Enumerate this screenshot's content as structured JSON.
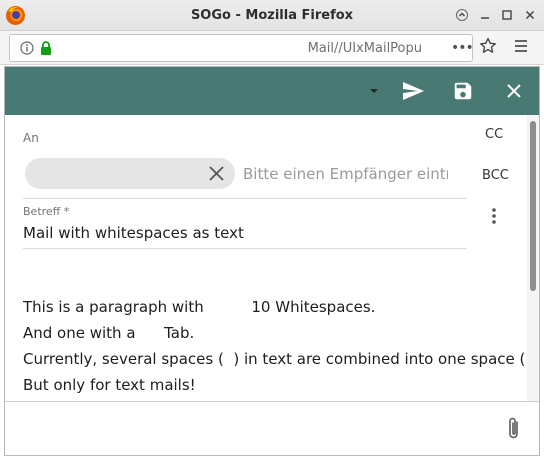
{
  "window": {
    "title": "SOGo - Mozilla Firefox",
    "controls": [
      "scroll-up",
      "minimize",
      "maximize",
      "close"
    ]
  },
  "browser": {
    "url": "Mail//UIxMailPopu",
    "page_actions_label": "•••",
    "icons": [
      "info-icon",
      "lock-icon",
      "star-icon",
      "hamburger-menu-icon"
    ]
  },
  "toolbar": {
    "accent_color": "#487a73",
    "icons": [
      "caret-down-icon",
      "send-icon",
      "save-icon",
      "close-icon"
    ]
  },
  "compose": {
    "to_label": "An",
    "recipient_placeholder": "Bitte einen Empfänger eintr",
    "cc_label": "CC",
    "bcc_label": "BCC",
    "subject_label": "Betreff *",
    "subject_value": "Mail with whitespaces as text",
    "body_lines": [
      "This is a paragraph with          10 Whitespaces.",
      "And one with a      Tab.",
      "Currently, several spaces (  ) in text are combined into one space ( ).",
      "But only for text mails!"
    ]
  }
}
